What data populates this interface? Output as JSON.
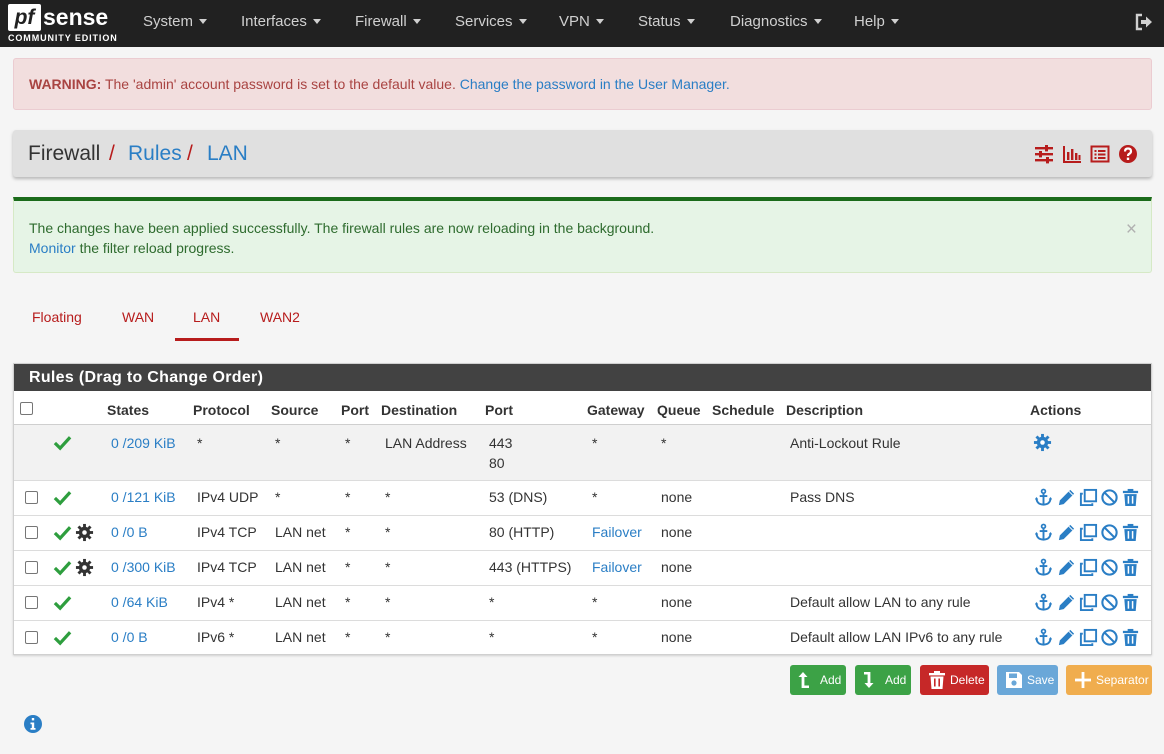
{
  "brand": {
    "logo_pf": "pf",
    "logo_sense": "sense",
    "logo_sub": "COMMUNITY EDITION"
  },
  "nav": {
    "items": [
      "System",
      "Interfaces",
      "Firewall",
      "Services",
      "VPN",
      "Status",
      "Diagnostics",
      "Help"
    ],
    "logout_icon": "sign-out-icon"
  },
  "warning": {
    "label": "WARNING:",
    "text": "The 'admin' account password is set to the default value.",
    "link": "Change the password in the User Manager."
  },
  "breadcrumb": {
    "items": [
      "Firewall",
      "Rules",
      "LAN"
    ],
    "separator": "/",
    "icons": [
      "sliders-icon",
      "bar-chart-icon",
      "list-alt-icon",
      "question-circle-icon"
    ]
  },
  "success": {
    "line1": "The changes have been applied successfully. The firewall rules are now reloading in the background.",
    "link": "Monitor",
    "line2_rest": " the filter reload progress.",
    "close": "×"
  },
  "tabs": {
    "items": [
      "Floating",
      "WAN",
      "LAN",
      "WAN2"
    ],
    "active": "LAN"
  },
  "rules_panel": {
    "title": "Rules (Drag to Change Order)",
    "columns": [
      "States",
      "Protocol",
      "Source",
      "Port",
      "Destination",
      "Port",
      "Gateway",
      "Queue",
      "Schedule",
      "Description",
      "Actions"
    ],
    "rows": [
      {
        "states": "0 /209 KiB",
        "protocol": "*",
        "source": "*",
        "sport": "*",
        "destination": "LAN Address",
        "dport": [
          "443",
          "80"
        ],
        "gateway": "*",
        "queue": "*",
        "schedule": "",
        "description": "Anti-Lockout Rule",
        "has_checkbox": false,
        "has_gear": false
      },
      {
        "states": "0 /121 KiB",
        "protocol": "IPv4 UDP",
        "source": "*",
        "sport": "*",
        "destination": "*",
        "dport": [
          "53 (DNS)"
        ],
        "gateway": "*",
        "queue": "none",
        "schedule": "",
        "description": "Pass DNS",
        "has_checkbox": true,
        "has_gear": false
      },
      {
        "states": "0 /0 B",
        "protocol": "IPv4 TCP",
        "source": "LAN net",
        "sport": "*",
        "destination": "*",
        "dport": [
          "80 (HTTP)"
        ],
        "gateway": "Failover",
        "queue": "none",
        "schedule": "",
        "description": "",
        "has_checkbox": true,
        "has_gear": true
      },
      {
        "states": "0 /300 KiB",
        "protocol": "IPv4 TCP",
        "source": "LAN net",
        "sport": "*",
        "destination": "*",
        "dport": [
          "443 (HTTPS)"
        ],
        "gateway": "Failover",
        "queue": "none",
        "schedule": "",
        "description": "",
        "has_checkbox": true,
        "has_gear": true
      },
      {
        "states": "0 /64 KiB",
        "protocol": "IPv4 *",
        "source": "LAN net",
        "sport": "*",
        "destination": "*",
        "dport": [
          "*"
        ],
        "gateway": "*",
        "queue": "none",
        "schedule": "",
        "description": "Default allow LAN to any rule",
        "has_checkbox": true,
        "has_gear": false
      },
      {
        "states": "0 /0 B",
        "protocol": "IPv6 *",
        "source": "LAN net",
        "sport": "*",
        "destination": "*",
        "dport": [
          "*"
        ],
        "gateway": "*",
        "queue": "none",
        "schedule": "",
        "description": "Default allow LAN IPv6 to any rule",
        "has_checkbox": true,
        "has_gear": false
      }
    ]
  },
  "buttons": {
    "add_top": "Add",
    "add_bottom": "Add",
    "delete": "Delete",
    "save": "Save",
    "separator": "Separator"
  },
  "colors": {
    "navbar": "#212121",
    "accent_red": "#b71c1c",
    "link_blue": "#2a7ec5",
    "pass_green": "#2e9e3e",
    "btn_green": "#3ca246",
    "btn_red": "#c62828",
    "btn_blue": "#6aa7d8",
    "btn_orange": "#f0ad4e"
  }
}
